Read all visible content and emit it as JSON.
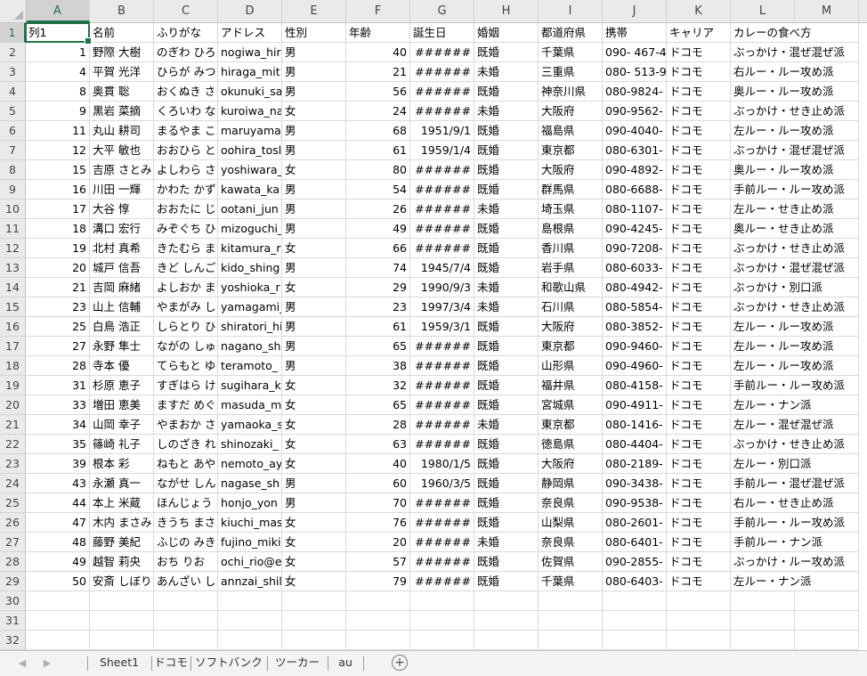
{
  "columns": [
    "A",
    "B",
    "C",
    "D",
    "E",
    "F",
    "G",
    "H",
    "I",
    "J",
    "K",
    "L",
    "M"
  ],
  "selected_column": "A",
  "selected_row": 1,
  "header_row": [
    "列1",
    "名前",
    "ふりがな",
    "アドレス",
    "性別",
    "年齢",
    "誕生日",
    "婚姻",
    "都道府県",
    "携帯",
    "キャリア",
    "カレーの食べ方",
    ""
  ],
  "rows": [
    [
      "1",
      "野際 大樹",
      "のぎわ ひろ",
      "nogiwa_hir",
      "男",
      "40",
      "######",
      "既婚",
      "千葉県",
      "090- 467-4",
      "ドコモ",
      "ぶっかけ・混ぜ混ぜ派",
      ""
    ],
    [
      "4",
      "平賀 光洋",
      "ひらが みつ",
      "hiraga_mit",
      "男",
      "21",
      "######",
      "未婚",
      "三重県",
      "080- 513-9",
      "ドコモ",
      "右ルー・ルー攻め派",
      ""
    ],
    [
      "8",
      "奥貫 聡",
      "おくぬき さ",
      "okunuki_sa",
      "男",
      "56",
      "######",
      "既婚",
      "神奈川県",
      "080-9824-",
      "ドコモ",
      "奥ルー・ルー攻め派",
      ""
    ],
    [
      "9",
      "黒岩 菜摘",
      "くろいわ な",
      "kuroiwa_na",
      "女",
      "24",
      "######",
      "未婚",
      "大阪府",
      "090-9562-",
      "ドコモ",
      "ぶっかけ・せき止め派",
      ""
    ],
    [
      "11",
      "丸山 耕司",
      "まるやま こ",
      "maruyama_",
      "男",
      "68",
      "1951/9/1",
      "既婚",
      "福島県",
      "090-4040-",
      "ドコモ",
      "左ルー・ルー攻め派",
      ""
    ],
    [
      "12",
      "大平 敏也",
      "おおひら と",
      "oohira_tosl",
      "男",
      "61",
      "1959/1/4",
      "既婚",
      "東京都",
      "080-6301-",
      "ドコモ",
      "ぶっかけ・混ぜ混ぜ派",
      ""
    ],
    [
      "15",
      "吉原 さとみ",
      "よしわら さ",
      "yoshiwara_",
      "女",
      "80",
      "######",
      "既婚",
      "大阪府",
      "090-4892-",
      "ドコモ",
      "奥ルー・ルー攻め派",
      ""
    ],
    [
      "16",
      "川田 一輝",
      "かわた かず",
      "kawata_ka",
      "男",
      "54",
      "######",
      "既婚",
      "群馬県",
      "080-6688-",
      "ドコモ",
      "手前ルー・ルー攻め派",
      ""
    ],
    [
      "17",
      "大谷 惇",
      "おおたに じ",
      "ootani_jun",
      "男",
      "26",
      "######",
      "未婚",
      "埼玉県",
      "080-1107-",
      "ドコモ",
      "左ルー・せき止め派",
      ""
    ],
    [
      "18",
      "溝口 宏行",
      "みぞぐち ひ",
      "mizoguchi_",
      "男",
      "49",
      "######",
      "既婚",
      "島根県",
      "090-4245-",
      "ドコモ",
      "奥ルー・せき止め派",
      ""
    ],
    [
      "19",
      "北村 真希",
      "きたむら ま",
      "kitamura_r",
      "女",
      "66",
      "######",
      "既婚",
      "香川県",
      "090-7208-",
      "ドコモ",
      "ぶっかけ・せき止め派",
      ""
    ],
    [
      "20",
      "城戸 信吾",
      "きど しんご",
      "kido_shing",
      "男",
      "74",
      "1945/7/4",
      "既婚",
      "岩手県",
      "080-6033-",
      "ドコモ",
      "ぶっかけ・混ぜ混ぜ派",
      ""
    ],
    [
      "21",
      "吉岡 麻緒",
      "よしおか ま",
      "yoshioka_r",
      "女",
      "29",
      "1990/9/3",
      "未婚",
      "和歌山県",
      "080-4942-",
      "ドコモ",
      "ぶっかけ・別口派",
      ""
    ],
    [
      "23",
      "山上 信輔",
      "やまがみ し",
      "yamagami_",
      "男",
      "23",
      "1997/3/4",
      "未婚",
      "石川県",
      "080-5854-",
      "ドコモ",
      "ぶっかけ・せき止め派",
      ""
    ],
    [
      "25",
      "白鳥 浩正",
      "しらとり ひ",
      "shiratori_hi",
      "男",
      "61",
      "1959/3/1",
      "既婚",
      "大阪府",
      "080-3852-",
      "ドコモ",
      "左ルー・ルー攻め派",
      ""
    ],
    [
      "27",
      "永野 隼士",
      "ながの しゅ",
      "nagano_sh",
      "男",
      "65",
      "######",
      "既婚",
      "東京都",
      "090-9460-",
      "ドコモ",
      "左ルー・ルー攻め派",
      ""
    ],
    [
      "28",
      "寺本 優",
      "てらもと ゆ",
      "teramoto_",
      "男",
      "38",
      "######",
      "既婚",
      "山形県",
      "090-4960-",
      "ドコモ",
      "左ルー・ルー攻め派",
      ""
    ],
    [
      "31",
      "杉原 恵子",
      "すぎはら け",
      "sugihara_k",
      "女",
      "32",
      "######",
      "既婚",
      "福井県",
      "080-4158-",
      "ドコモ",
      "手前ルー・ルー攻め派",
      ""
    ],
    [
      "33",
      "増田 恵美",
      "ますだ めぐ",
      "masuda_m",
      "女",
      "65",
      "######",
      "既婚",
      "宮城県",
      "090-4911-",
      "ドコモ",
      "左ルー・ナン派",
      ""
    ],
    [
      "34",
      "山岡 幸子",
      "やまおか さ",
      "yamaoka_s",
      "女",
      "28",
      "######",
      "未婚",
      "東京都",
      "080-1416-",
      "ドコモ",
      "左ルー・混ぜ混ぜ派",
      ""
    ],
    [
      "35",
      "篠崎 礼子",
      "しのざき れ",
      "shinozaki_",
      "女",
      "63",
      "######",
      "既婚",
      "徳島県",
      "080-4404-",
      "ドコモ",
      "ぶっかけ・せき止め派",
      ""
    ],
    [
      "39",
      "根本 彩",
      "ねもと あや",
      "nemoto_ay",
      "女",
      "40",
      "1980/1/5",
      "既婚",
      "大阪府",
      "080-2189-",
      "ドコモ",
      "左ルー・別口派",
      ""
    ],
    [
      "43",
      "永瀬 真一",
      "ながせ しん",
      "nagase_sh",
      "男",
      "60",
      "1960/3/5",
      "既婚",
      "静岡県",
      "090-3438-",
      "ドコモ",
      "手前ルー・混ぜ混ぜ派",
      ""
    ],
    [
      "44",
      "本上 米蔵",
      "ほんじょう",
      "honjo_yon",
      "男",
      "70",
      "######",
      "既婚",
      "奈良県",
      "090-9538-",
      "ドコモ",
      "右ルー・せき止め派",
      ""
    ],
    [
      "47",
      "木内 まさみ",
      "きうち まさ",
      "kiuchi_mas",
      "女",
      "76",
      "######",
      "既婚",
      "山梨県",
      "080-2601-",
      "ドコモ",
      "手前ルー・ルー攻め派",
      ""
    ],
    [
      "48",
      "藤野 美紀",
      "ふじの みき",
      "fujino_miki",
      "女",
      "20",
      "######",
      "未婚",
      "奈良県",
      "080-6401-",
      "ドコモ",
      "手前ルー・ナン派",
      ""
    ],
    [
      "49",
      "越智 莉央",
      "おち りお",
      "ochi_rio@e",
      "女",
      "57",
      "######",
      "既婚",
      "佐賀県",
      "090-2855-",
      "ドコモ",
      "ぶっかけ・ルー攻め派",
      ""
    ],
    [
      "50",
      "安斎 しぼり",
      "あんざい し",
      "annzai_shil",
      "女",
      "79",
      "######",
      "既婚",
      "千葉県",
      "080-6403-",
      "ドコモ",
      "左ルー・ナン派",
      ""
    ]
  ],
  "empty_rows": [
    30,
    31,
    32
  ],
  "sheet_tabs": [
    "Sheet1",
    "ドコモ",
    "ソフトバンク",
    "ツーカー",
    "au"
  ],
  "add_sheet_symbol": "+",
  "nav_prev_symbol": "◀",
  "nav_next_symbol": "▶",
  "colors": {
    "accent": "#217346",
    "header_bg": "#eaeaea",
    "grid": "#dadada"
  }
}
